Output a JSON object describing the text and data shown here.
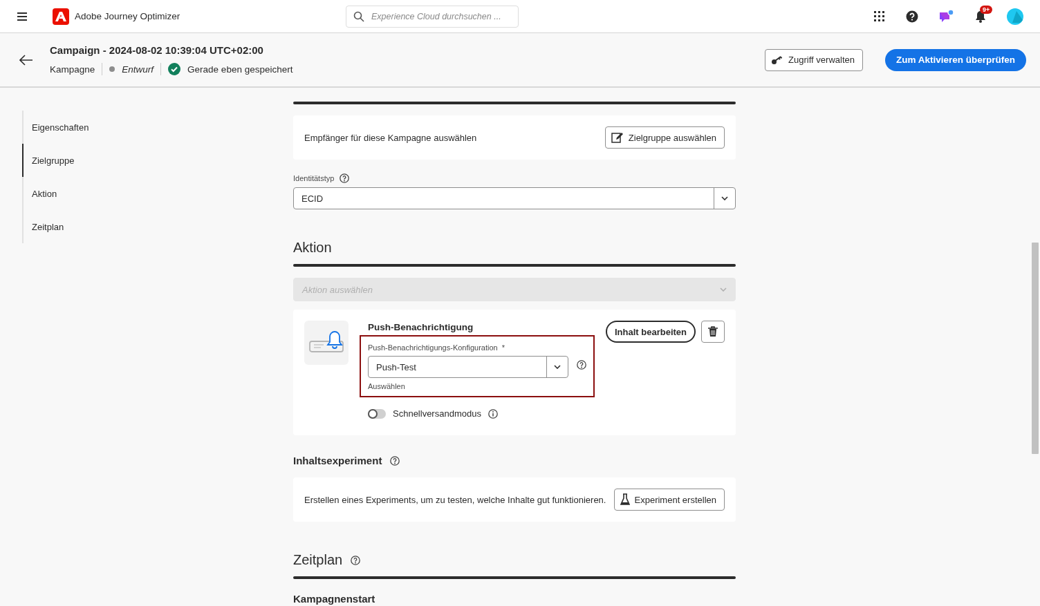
{
  "app_bar": {
    "product": "Adobe Journey Optimizer",
    "search": {
      "placeholder": "Experience Cloud durchsuchen ..."
    },
    "notification_badge": "9+"
  },
  "campaign_header": {
    "title": "Campaign - 2024-08-02 10:39:04 UTC+02:00",
    "type": "Kampagne",
    "status": "Entwurf",
    "save_state": "Gerade eben gespeichert",
    "buttons": [
      {
        "label": "Zugriff verwalten",
        "kind": "secondary"
      },
      {
        "label": "Zum Aktivieren überprüfen",
        "kind": "primary"
      }
    ]
  },
  "nav": [
    {
      "label": "Eigenschaften",
      "selected": false
    },
    {
      "label": "Zielgruppe",
      "selected": true
    },
    {
      "label": "Aktion",
      "selected": false
    },
    {
      "label": "Zeitplan",
      "selected": false
    }
  ],
  "audience": {
    "text": "Empfänger für diese Kampagne auswählen",
    "button": "Zielgruppe auswählen",
    "identity_label": "Identitätstyp",
    "identity_value": "ECID"
  },
  "action": {
    "heading": "Aktion",
    "select": {
      "placeholder": "Aktion auswählen",
      "disabled": true
    },
    "card": {
      "title": "Push-Benachrichtigung",
      "config_label": "Push-Benachrichtigungs-Konfiguration",
      "required_mark": "*",
      "config_value": "Push-Test",
      "helper": "Auswählen",
      "edit_button": "Inhalt bearbeiten",
      "toggle": {
        "label": "Schnellversandmodus",
        "on": false
      }
    }
  },
  "experiment": {
    "heading": "Inhaltsexperiment",
    "text": "Erstellen eines Experiments, um zu testen, welche Inhalte gut funktionieren.",
    "button": "Experiment erstellen"
  },
  "schedule": {
    "heading": "Zeitplan",
    "subheading": "Kampagnenstart"
  }
}
